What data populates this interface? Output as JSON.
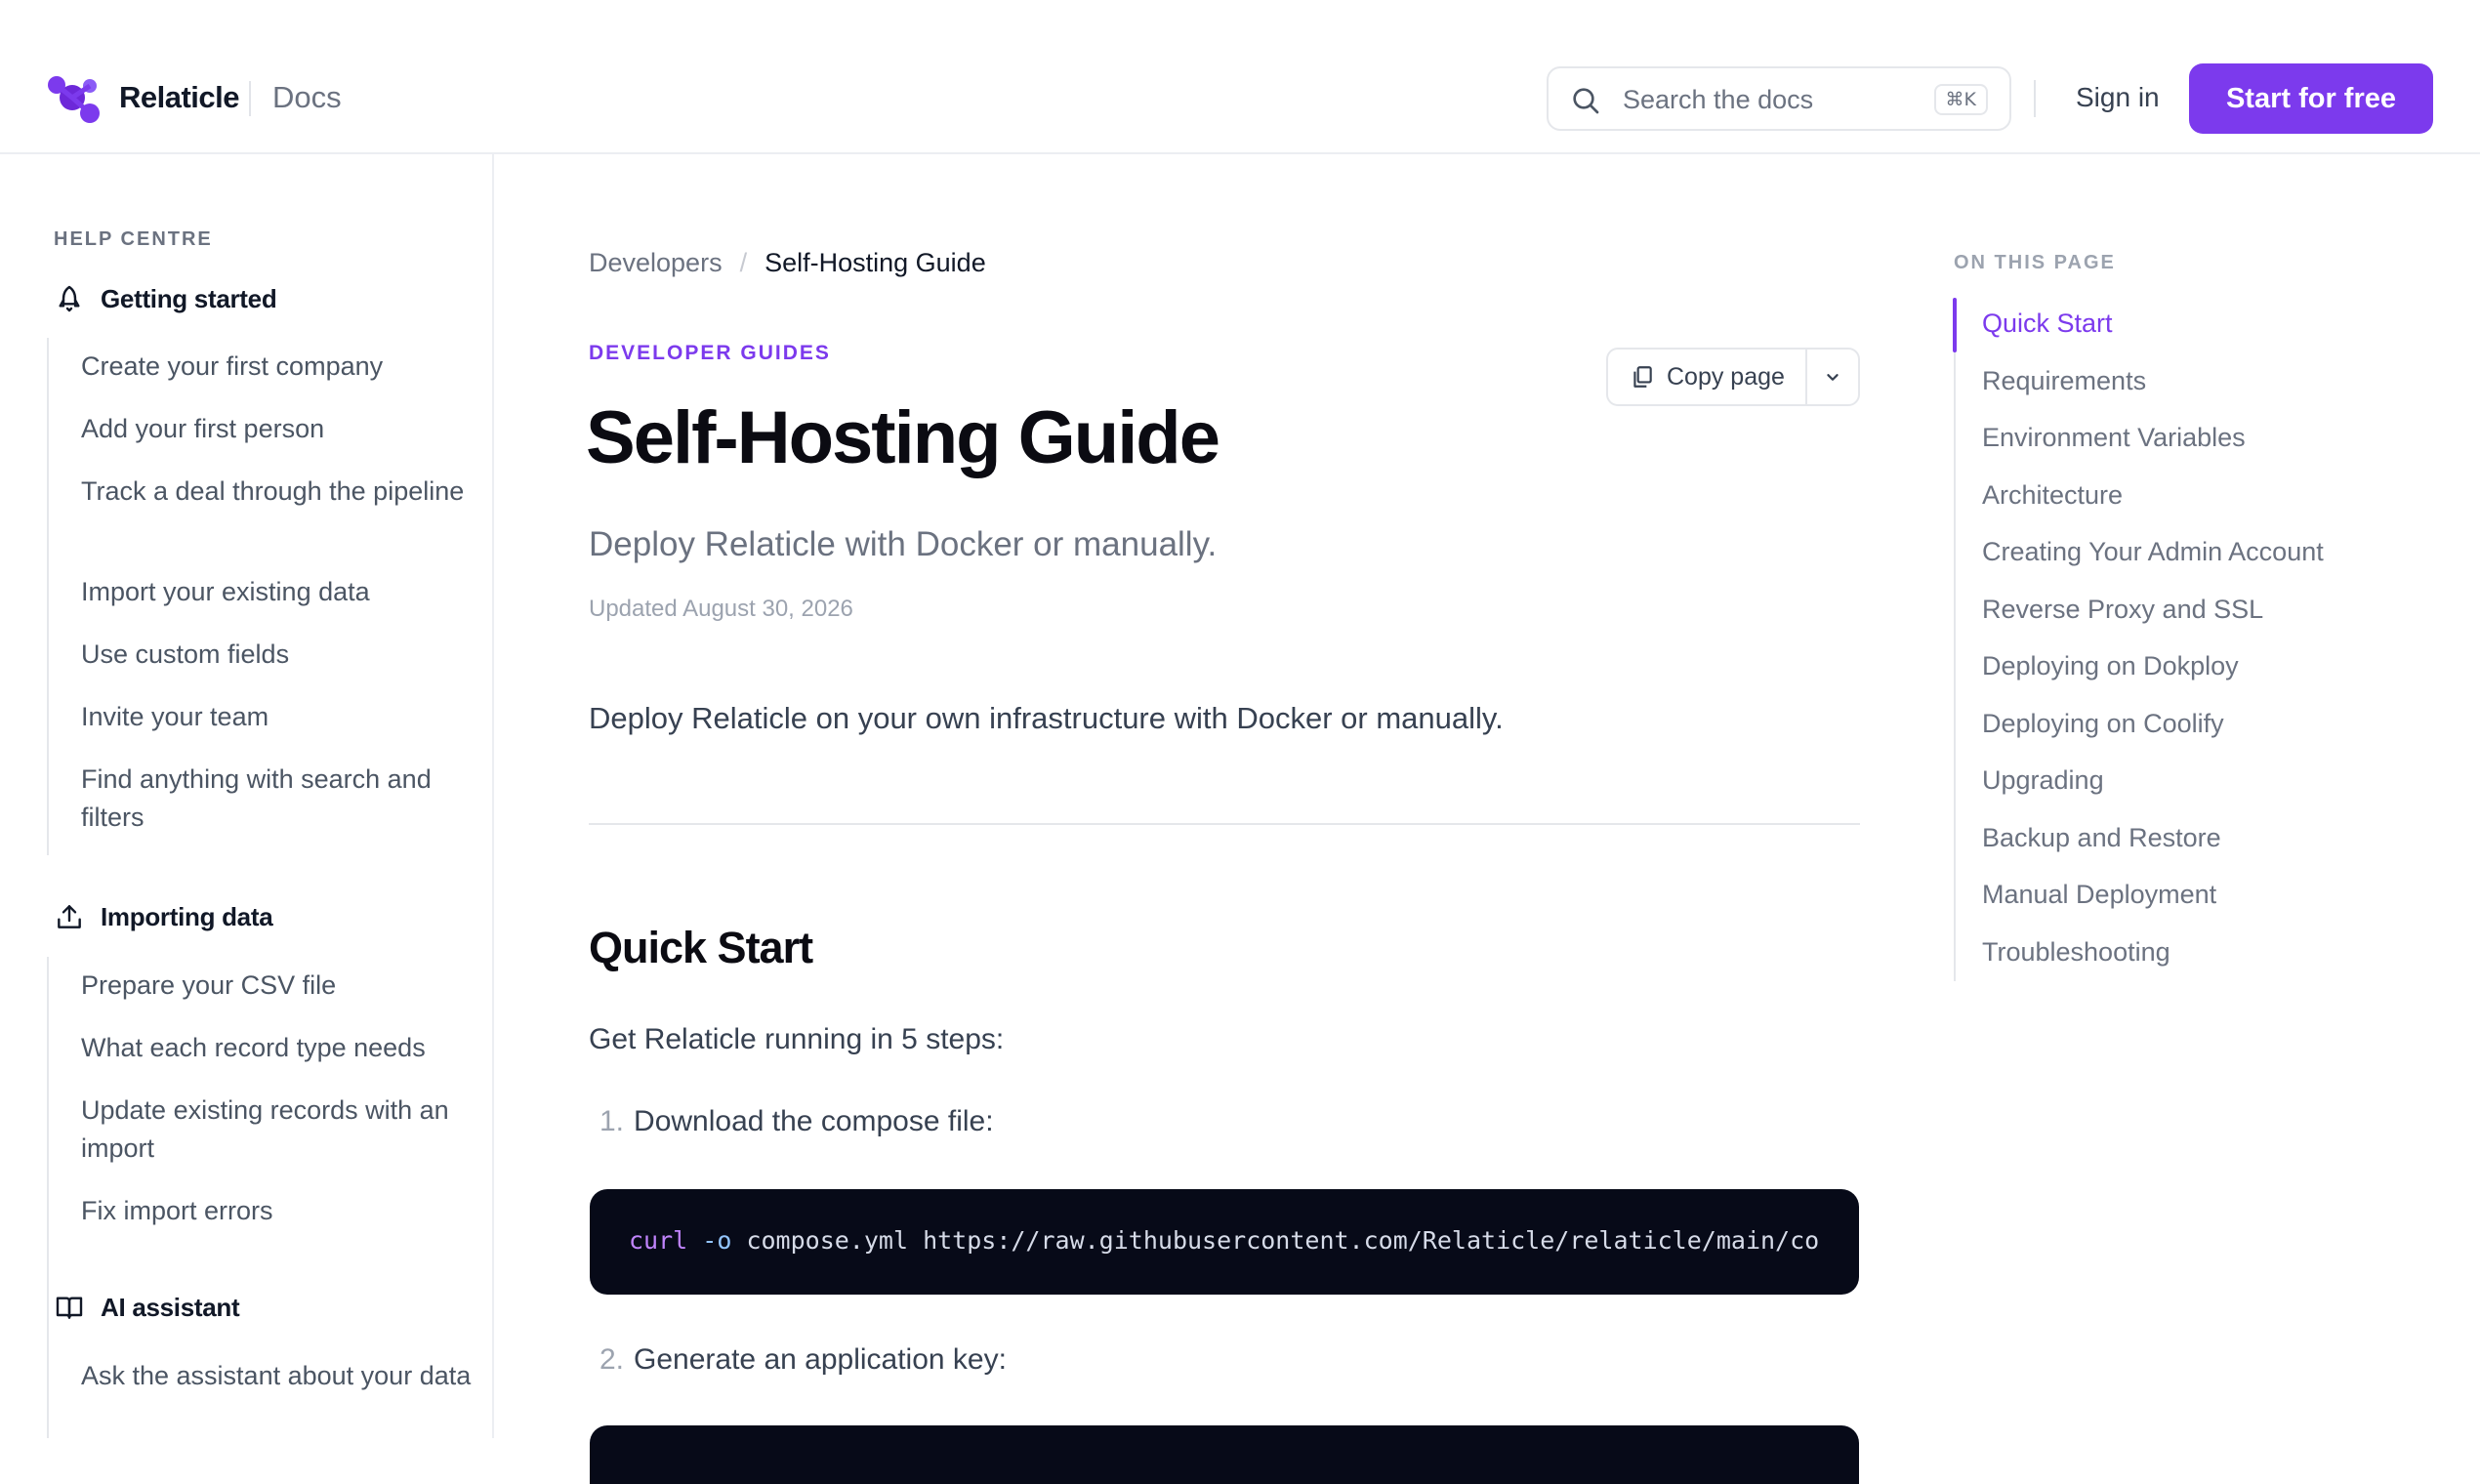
{
  "header": {
    "brand": "Relaticle",
    "section": "Docs",
    "search_placeholder": "Search the docs",
    "search_shortcut": "⌘K",
    "sign_in": "Sign in",
    "cta": "Start for free",
    "accent_color": "#7c3aed"
  },
  "sidebar": {
    "heading": "HELP CENTRE",
    "sections": [
      {
        "title": "Getting started",
        "icon": "rocket-icon",
        "items": [
          "Create your first company",
          "Add your first person",
          "Track a deal through the pipeline",
          "Import your existing data",
          "Use custom fields",
          "Invite your team",
          "Find anything with search and filters"
        ]
      },
      {
        "title": "Importing data",
        "icon": "upload-icon",
        "items": [
          "Prepare your CSV file",
          "What each record type needs",
          "Update existing records with an import",
          "Fix import errors"
        ]
      },
      {
        "title": "AI assistant",
        "icon": "book-icon",
        "items": [
          "Ask the assistant about your data"
        ]
      }
    ]
  },
  "main": {
    "breadcrumb": {
      "parent": "Developers",
      "separator": "/",
      "current": "Self-Hosting Guide"
    },
    "eyebrow": "DEVELOPER GUIDES",
    "title": "Self-Hosting Guide",
    "subtitle": "Deploy Relaticle with Docker or manually.",
    "updated": "Updated August 30, 2026",
    "copy_page": "Copy page",
    "intro": "Deploy Relaticle on your own infrastructure with Docker or manually.",
    "quick_start": {
      "heading": "Quick Start",
      "lead": "Get Relaticle running in 5 steps:",
      "steps": [
        {
          "num": "1.",
          "text": "Download the compose file:",
          "code": {
            "cmd": "curl",
            "flag": "-o",
            "rest": "compose.yml https://raw.githubusercontent.com/Relaticle/relaticle/main/co"
          }
        },
        {
          "num": "2.",
          "text": "Generate an application key:"
        }
      ]
    }
  },
  "toc": {
    "heading": "ON THIS PAGE",
    "active_index": 0,
    "items": [
      "Quick Start",
      "Requirements",
      "Environment Variables",
      "Architecture",
      "Creating Your Admin Account",
      "Reverse Proxy and SSL",
      "Deploying on Dokploy",
      "Deploying on Coolify",
      "Upgrading",
      "Backup and Restore",
      "Manual Deployment",
      "Troubleshooting"
    ]
  }
}
